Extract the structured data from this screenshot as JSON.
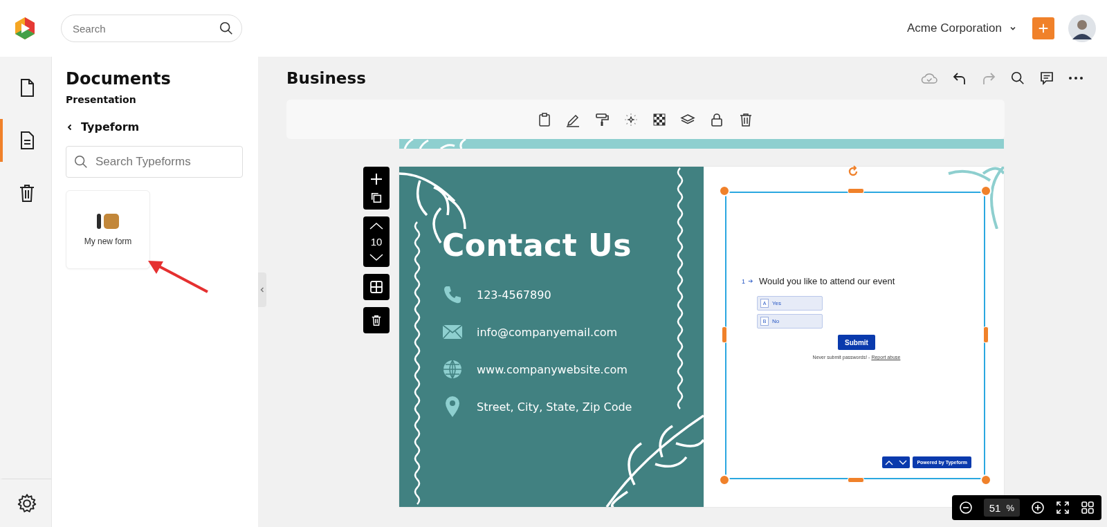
{
  "header": {
    "search_placeholder": "Search",
    "organization": "Acme Corporation"
  },
  "rail": [
    {
      "kind": "document",
      "selected": false
    },
    {
      "kind": "form",
      "selected": true
    },
    {
      "kind": "trash",
      "selected": false
    }
  ],
  "sidebar": {
    "title": "Documents",
    "subtitle": "Presentation",
    "back_label": "Typeform",
    "search_placeholder": "Search Typeforms",
    "forms": [
      {
        "name": "My new form"
      }
    ]
  },
  "main": {
    "title": "Business"
  },
  "slide_tools": {
    "page_number": "10"
  },
  "slide": {
    "heading": "Contact Us",
    "contacts": [
      {
        "kind": "phone",
        "text": "123-4567890"
      },
      {
        "kind": "mail",
        "text": "info@companyemail.com"
      },
      {
        "kind": "web",
        "text": "www.companywebsite.com"
      },
      {
        "kind": "pin",
        "text": "Street, City, State, Zip Code"
      }
    ]
  },
  "form": {
    "number": "1",
    "question": "Would you like to attend our event",
    "options": [
      {
        "key": "A",
        "label": "Yes"
      },
      {
        "key": "B",
        "label": "No"
      }
    ],
    "submit": "Submit",
    "notice": "Never submit passwords! - ",
    "report_link": "Report abuse",
    "badge": "Powered by Typeform"
  },
  "zoom": {
    "value": "51",
    "unit": "%"
  }
}
